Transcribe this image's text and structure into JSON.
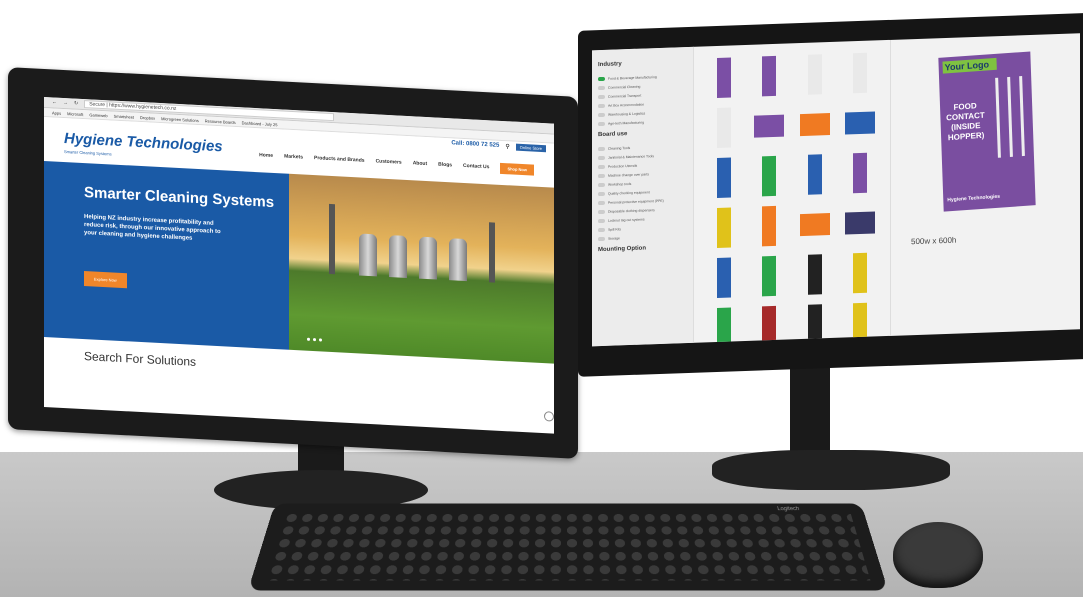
{
  "left_monitor": {
    "browser": {
      "url": "Secure | https://www.hygienetech.co.nz",
      "bookmarks": [
        "Apps",
        "Microsoft",
        "Gameweb",
        "Smartsheet",
        "Dropbox",
        "Microgreen Solutions",
        "Resource Boards",
        "Dashboard - July 25"
      ]
    },
    "site": {
      "call": "Call: 0800 72 525",
      "header_btn": "Online Store",
      "logo": "Hygiene Technologies",
      "logo_sub": "Smarter Cleaning Systems",
      "nav": [
        "Home",
        "Markets",
        "Products and Brands",
        "Customers",
        "About",
        "Blogs",
        "Contact Us"
      ],
      "shop_btn": "Shop Now",
      "hero_title": "Smarter Cleaning Systems",
      "hero_text": "Helping NZ industry increase profitability and reduce risk, through our innovative approach to your cleaning and hygiene challenges",
      "hero_btn": "Explore Now",
      "search_heading": "Search For Solutions"
    }
  },
  "right_monitor": {
    "industry_heading": "Industry",
    "industries": [
      "Food & Beverage Manufacturing",
      "Commercial Cleaning",
      "Commercial Transport",
      "Art Box Accommodation",
      "Warehousing & Logistics",
      "Agri-tech Manufacturing"
    ],
    "board_use_heading": "Board use",
    "board_uses": [
      "Cleaning Tools",
      "Janitorial & Maintenance Tools",
      "Production Utensils",
      "Machine change over parts",
      "Workshop tools",
      "Quality checking equipment",
      "Personal protective equipment (PPE)",
      "Disposable clothing dispensers",
      "Lockout tag out systems",
      "Spill Kits",
      "Storage"
    ],
    "mounting_heading": "Mounting Option",
    "board": {
      "logo": "Your Logo",
      "text": "FOOD CONTACT (INSIDE HOPPER)",
      "brand": "Hygiene Technologies"
    },
    "size": "500w x 600h",
    "thumb_colors": [
      "#7b4fa5",
      "#7b4fa5",
      "#e9e9e9",
      "#e9e9e9",
      "#e9e9e9",
      "#7b4fa5",
      "#f07a22",
      "#2a60b0",
      "#2a60b0",
      "#2aa54a",
      "#2a60b0",
      "#7b4fa5",
      "#e0c21a",
      "#f07a22",
      "#f07a22",
      "#3a3a6a",
      "#2a60b0",
      "#2aa54a",
      "#222222",
      "#e0c21a",
      "#2aa54a",
      "#a62a2a",
      "#222222",
      "#e0c21a"
    ]
  },
  "keyboard_brand": "Logitech"
}
